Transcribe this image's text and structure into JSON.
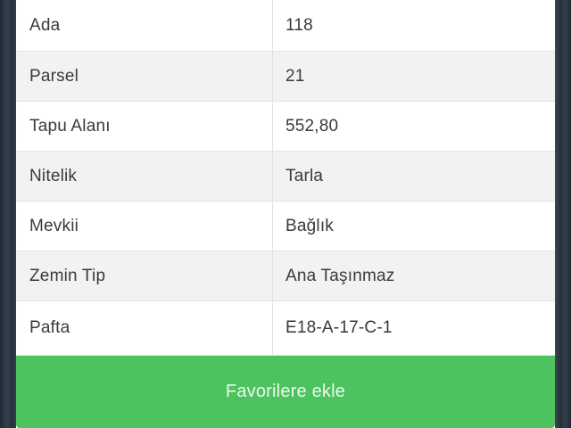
{
  "details": {
    "rows": [
      {
        "label": "Ada",
        "value": "118"
      },
      {
        "label": "Parsel",
        "value": "21"
      },
      {
        "label": "Tapu Alanı",
        "value": "552,80"
      },
      {
        "label": "Nitelik",
        "value": "Tarla"
      },
      {
        "label": "Mevkii",
        "value": "Bağlık"
      },
      {
        "label": "Zemin Tip",
        "value": "Ana Taşınmaz"
      },
      {
        "label": "Pafta",
        "value": "E18-A-17-C-1"
      }
    ]
  },
  "actions": {
    "favorite_label": "Favorilere ekle"
  },
  "colors": {
    "button_green": "#4cc35f",
    "row_alt": "#f2f2f2"
  }
}
